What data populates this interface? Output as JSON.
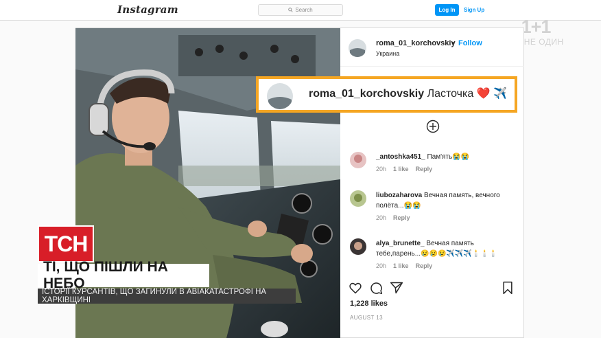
{
  "header": {
    "logo": "Instagram",
    "search_placeholder": "Search",
    "login": "Log In",
    "signup": "Sign Up"
  },
  "watermark": {
    "main": "1+1",
    "sub": "МИ НЕ ОДИН"
  },
  "post": {
    "username": "roma_01_korchovskiy",
    "dot": "•",
    "follow": "Follow",
    "location": "Украина",
    "callout_username": "roma_01_korchovskiy",
    "caption": "Ласточка ❤️ ✈️",
    "comments": [
      {
        "user": "_antoshka451_",
        "text": "Пам'ять😭😭",
        "time": "20h",
        "likes": "1 like",
        "reply": "Reply"
      },
      {
        "user": "liubozaharova",
        "text": "Вечная память, вечного полёта...😭😭",
        "time": "20h",
        "likes": "",
        "reply": "Reply"
      },
      {
        "user": "alya_brunette_",
        "text": "Вечная память тебе,парень...😢😢😢✈️✈️✈️🕯️🕯️🕯️",
        "time": "20h",
        "likes": "1 like",
        "reply": "Reply"
      }
    ],
    "likes": "1,228 likes",
    "date": "AUGUST 13"
  },
  "news": {
    "logo": "ТСН",
    "headline": "ТІ, ЩО ПІШЛИ НА НЕБО",
    "subline": "ІСТОРІЇ КУРСАНТІВ, ЩО ЗАГИНУЛИ В АВІАКАТАСТРОФІ НА ХАРКІВЩИНІ"
  },
  "icons": {
    "search": "search-icon",
    "plus": "plus-circle-icon",
    "like": "heart-icon",
    "comment": "comment-icon",
    "share": "share-icon",
    "save": "bookmark-icon"
  },
  "colors": {
    "accent": "#0095f6",
    "callout_border": "#f5a623",
    "tsn_red": "#d81e28"
  }
}
